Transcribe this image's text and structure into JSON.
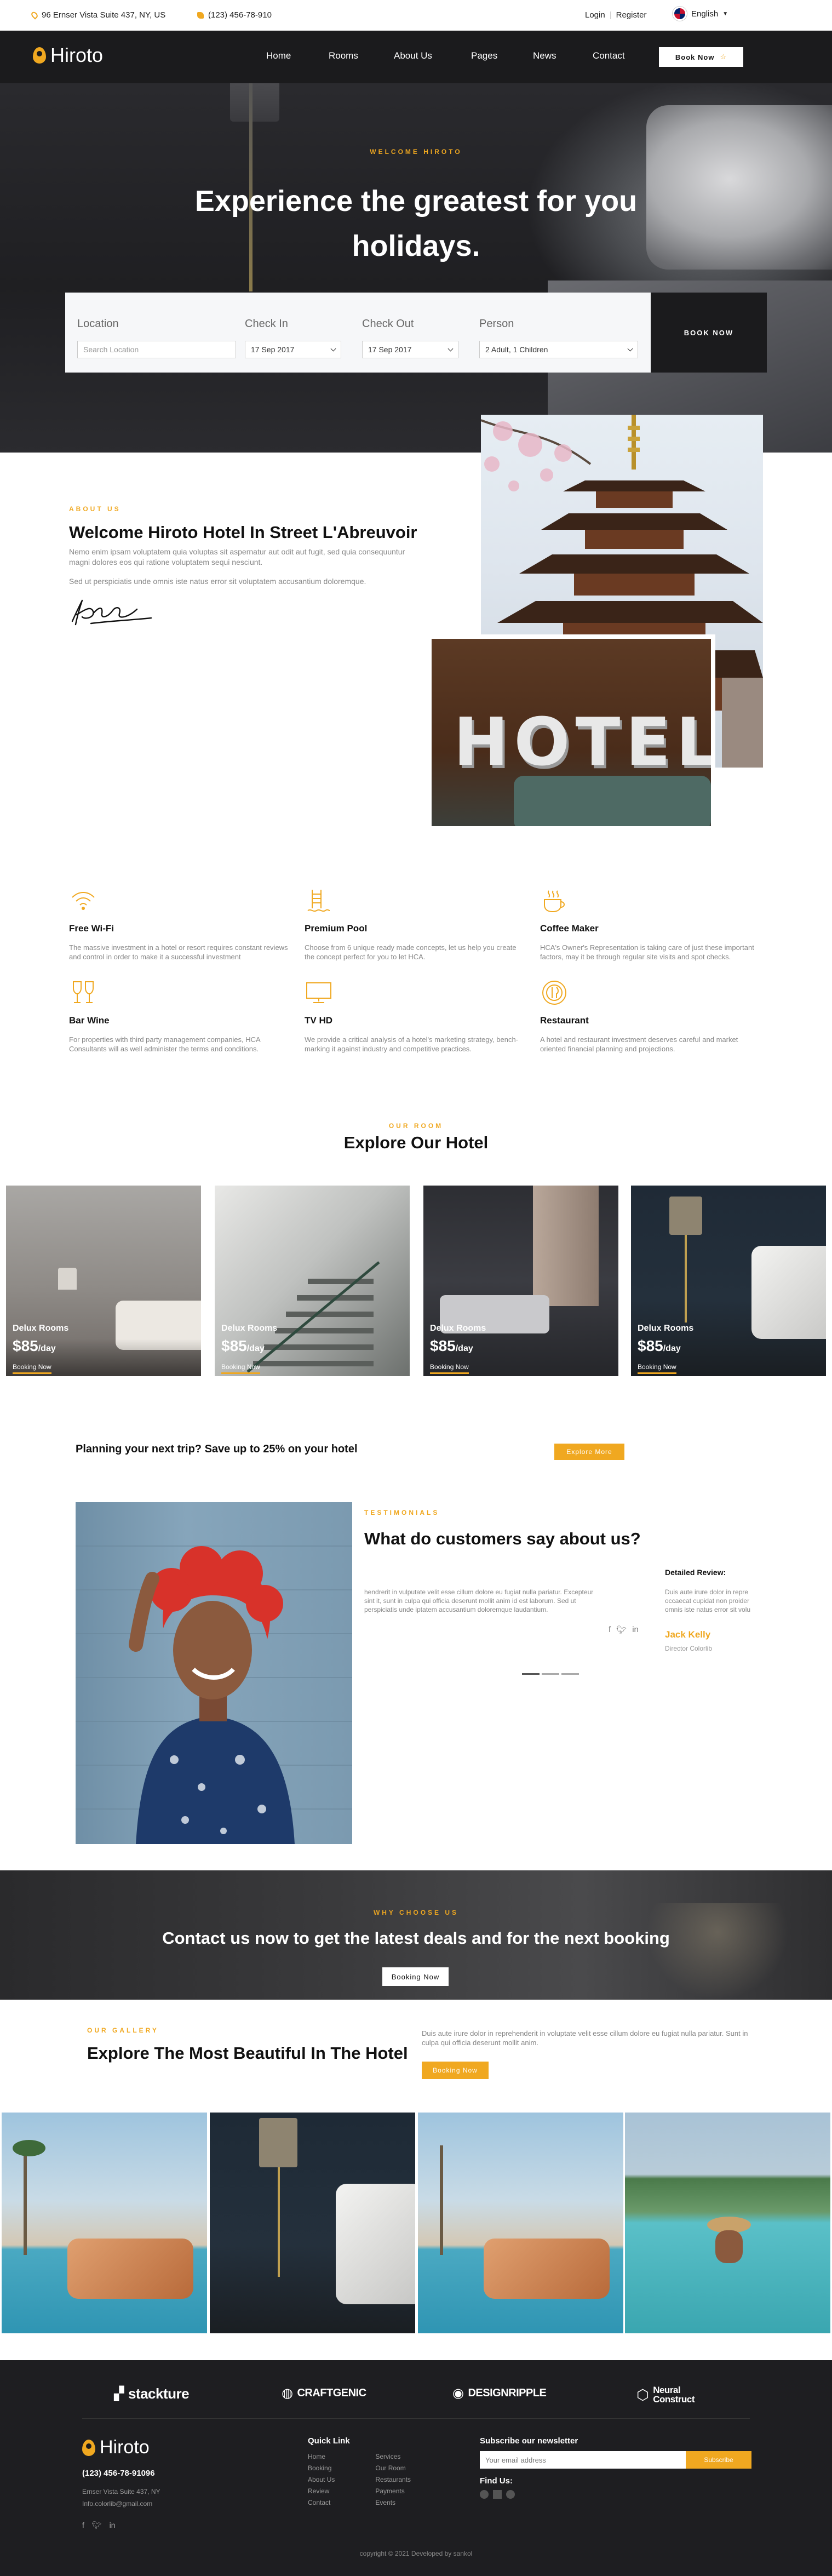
{
  "topbar": {
    "address": "96 Ernser Vista Suite 437, NY, US",
    "phone": "(123) 456-78-910",
    "login": "Login",
    "register": "Register",
    "language": "English"
  },
  "nav": {
    "logo": "Hiroto",
    "items": [
      "Home",
      "Rooms",
      "About Us",
      "Pages",
      "News",
      "Contact"
    ],
    "book_now": "Book Now"
  },
  "hero": {
    "eyebrow": "WELCOME HIROTO",
    "title_line1": "Experience the greatest for you",
    "title_line2": "holidays."
  },
  "booking": {
    "location_label": "Location",
    "location_placeholder": "Search Location",
    "checkin_label": "Check In",
    "checkin_value": "17 Sep 2017",
    "checkout_label": "Check Out",
    "checkout_value": "17 Sep 2017",
    "person_label": "Person",
    "person_value": "2 Adult, 1 Children",
    "button": "BOOK NOW"
  },
  "about": {
    "eyebrow": "ABOUT US",
    "title": "Welcome Hiroto Hotel In Street L'Abreuvoir",
    "p1": "Nemo enim ipsam voluptatem quia voluptas sit aspernatur aut odit aut fugit, sed quia consequuntur magni dolores eos qui ratione voluptatem sequi nesciunt.",
    "p2": "Sed ut perspiciatis unde omnis iste natus error sit voluptatem accusantium doloremque.",
    "hotel_sign": "HOTEL"
  },
  "features": [
    {
      "icon": "wifi-icon",
      "title": "Free Wi-Fi",
      "text": "The massive investment in a hotel or resort requires constant reviews and control in order to make it a successful investment"
    },
    {
      "icon": "pool-icon",
      "title": "Premium Pool",
      "text": "Choose from 6 unique ready made concepts, let us help you create the concept perfect for you to let HCA."
    },
    {
      "icon": "coffee-icon",
      "title": "Coffee Maker",
      "text": "HCA's Owner's Representation is taking care of just these important factors, may it be through regular site visits and spot checks."
    },
    {
      "icon": "wine-icon",
      "title": "Bar Wine",
      "text": "For properties with third party management companies, HCA Consultants will as well administer the terms and conditions."
    },
    {
      "icon": "tv-icon",
      "title": "TV HD",
      "text": "We provide a critical analysis of a hotel's marketing strategy, bench-marking it against industry and competitive practices."
    },
    {
      "icon": "restaurant-icon",
      "title": "Restaurant",
      "text": "A hotel and restaurant investment deserves careful and market oriented financial planning and projections."
    }
  ],
  "rooms": {
    "eyebrow": "OUR ROOM",
    "title": "Explore Our Hotel",
    "items": [
      {
        "name": "Delux Rooms",
        "price": "$85",
        "unit": "/day",
        "cta": "Booking Now"
      },
      {
        "name": "Delux Rooms",
        "price": "$85",
        "unit": "/day",
        "cta": "Booking Now"
      },
      {
        "name": "Delux Rooms",
        "price": "$85",
        "unit": "/day",
        "cta": "Booking Now"
      },
      {
        "name": "Delux Rooms",
        "price": "$85",
        "unit": "/day",
        "cta": "Booking Now"
      }
    ]
  },
  "promo": {
    "text": "Planning your next trip? Save up to 25% on your hotel",
    "button": "Explore More"
  },
  "testimonial": {
    "eyebrow": "TESTIMONIALS",
    "title": "What do customers say about us?",
    "text": "hendrerit in vulputate velit esse cillum dolore eu fugiat nulla pariatur. Excepteur sint it, sunt in culpa qui officia deserunt mollit anim id est laborum. Sed ut perspiciatis unde iptatem accusantium doloremque laudantium.",
    "review_title": "Detailed Review:",
    "review_text": "Duis aute irure dolor in repre occaecat cupidat non proider omnis iste natus error sit volu",
    "name": "Jack Kelly",
    "role": "Director Colorlib"
  },
  "cta": {
    "eyebrow": "WHY CHOOSE US",
    "title": "Contact us now to get the latest deals and for the next booking",
    "button": "Booking Now"
  },
  "gallery": {
    "eyebrow": "OUR GALLERY",
    "title": "Explore The Most Beautiful In The Hotel",
    "text": "Duis aute irure dolor in reprehenderit in voluptate velit esse cillum dolore eu fugiat nulla pariatur. Sunt in culpa qui officia deserunt mollit anim.",
    "button": "Booking Now"
  },
  "partners": [
    "stackture",
    "CRAFTGENIC",
    "DESIGNRIPPLE",
    "Neural Construct"
  ],
  "footer": {
    "logo": "Hiroto",
    "phone": "(123) 456-78-91096",
    "address": "Ernser Vista Suite 437, NY",
    "email": "Info.colorlib@gmail.com",
    "quick_title": "Quick Link",
    "links_a": [
      "Home",
      "Booking",
      "About Us",
      "Review",
      "Contact"
    ],
    "links_b": [
      "Services",
      "Our Room",
      "Restaurants",
      "Payments",
      "Events"
    ],
    "news_title": "Subscribe our newsletter",
    "email_placeholder": "Your email address",
    "subscribe": "Subscribe",
    "find_us": "Find Us:",
    "copyright": "copyright © 2021 Developed by sankol"
  },
  "colors": {
    "accent": "#f0a820",
    "dark": "#1b1b1d"
  }
}
